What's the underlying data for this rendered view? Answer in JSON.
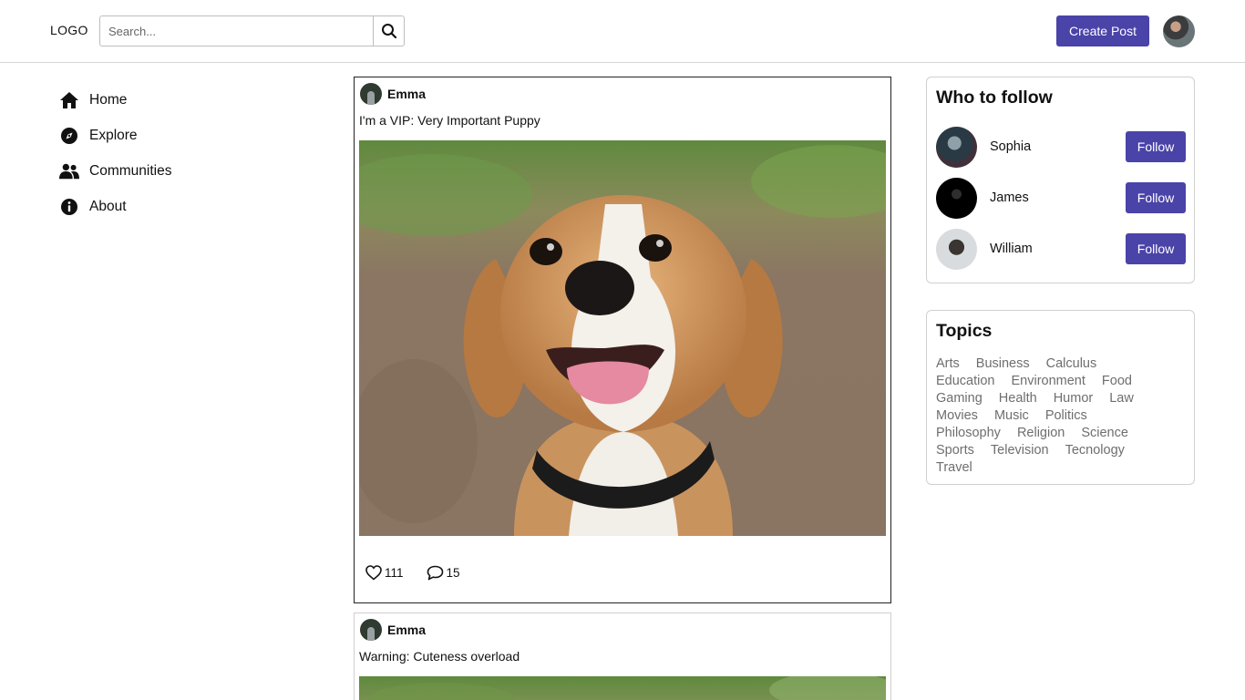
{
  "header": {
    "logo": "LOGO",
    "search_placeholder": "Search...",
    "create_post_label": "Create Post",
    "icons": {
      "search": "search-icon",
      "avatar": "user-avatar"
    }
  },
  "nav": {
    "items": [
      {
        "label": "Home",
        "icon": "home-icon"
      },
      {
        "label": "Explore",
        "icon": "compass-icon"
      },
      {
        "label": "Communities",
        "icon": "users-icon"
      },
      {
        "label": "About",
        "icon": "info-icon"
      }
    ]
  },
  "feed": {
    "posts": [
      {
        "author": "Emma",
        "caption": "I'm a VIP: Very Important Puppy",
        "image": "beagle-puppy-photo",
        "likes": "111",
        "comments": "15"
      },
      {
        "author": "Emma",
        "caption": "Warning: Cuteness overload",
        "image": "dog-photo"
      }
    ]
  },
  "who_to_follow": {
    "title": "Who to follow",
    "users": [
      {
        "name": "Sophia",
        "button": "Follow"
      },
      {
        "name": "James",
        "button": "Follow"
      },
      {
        "name": "William",
        "button": "Follow"
      }
    ]
  },
  "topics": {
    "title": "Topics",
    "items": [
      "Arts",
      "Business",
      "Calculus",
      "Education",
      "Environment",
      "Food",
      "Gaming",
      "Health",
      "Humor",
      "Law",
      "Movies",
      "Music",
      "Politics",
      "Philosophy",
      "Religion",
      "Science",
      "Sports",
      "Television",
      "Tecnology",
      "Travel"
    ]
  },
  "colors": {
    "accent": "#4a43a8",
    "topic_text": "#6e6e6e",
    "border": "#d0d0d0"
  }
}
